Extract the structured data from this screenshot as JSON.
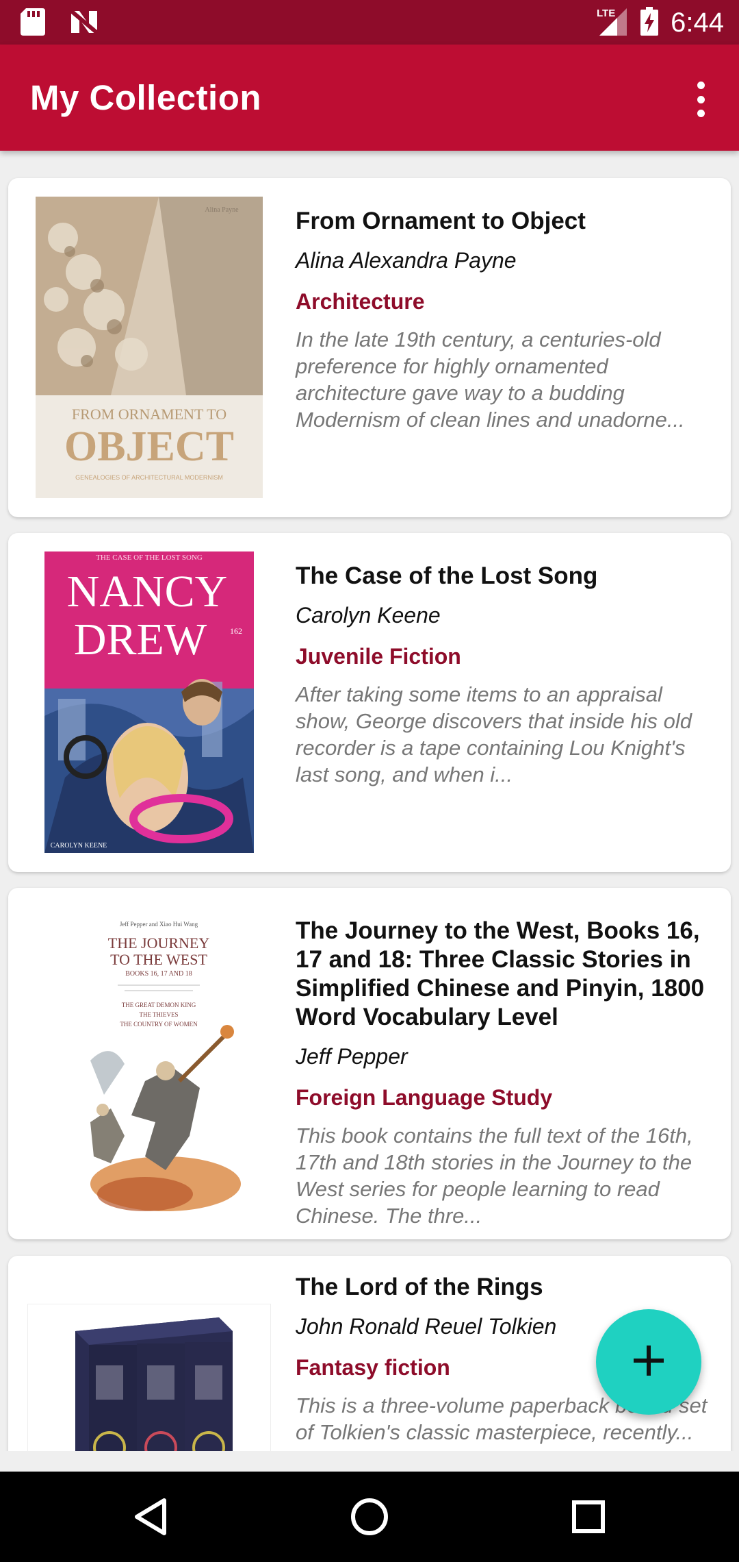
{
  "status_bar": {
    "time": "6:44",
    "network": "LTE",
    "icons": [
      "sd-card-icon",
      "notification-n-icon",
      "signal-icon",
      "battery-charging-icon"
    ]
  },
  "app_bar": {
    "title": "My Collection",
    "menu_icon": "overflow-menu-icon"
  },
  "books": [
    {
      "title": "From Ornament to Object",
      "author": "Alina Alexandra Payne",
      "category": "Architecture",
      "description": "In the late 19th century, a centuries-old preference for highly ornamented architecture gave way to a budding Modernism of clean lines and unadorne...",
      "cover": {
        "author_text": "Alina Payne",
        "line1": "FROM ORNAMENT TO",
        "line2": "OBJECT",
        "line3": "GENEALOGIES OF ARCHITECTURAL MODERNISM"
      }
    },
    {
      "title": "The Case of the Lost Song",
      "author": "Carolyn Keene",
      "category": "Juvenile Fiction",
      "description": "After taking some items to an appraisal show, George discovers that inside his old recorder is a tape containing Lou Knight's last song, and when i...",
      "cover": {
        "top_text": "THE CASE OF THE LOST SONG",
        "line1": "NANCY",
        "line2": "DREW",
        "number": "162",
        "author_text": "CAROLYN KEENE"
      }
    },
    {
      "title": "The Journey to the West, Books 16, 17 and 18: Three Classic Stories in Simplified Chinese and Pinyin, 1800 Word Vocabulary Level",
      "author": "Jeff Pepper",
      "category": "Foreign Language Study",
      "description": "This book contains the full text of the 16th, 17th and 18th stories in the Journey to the West series for people learning to read Chinese. The thre...",
      "cover": {
        "authors_text": "Jeff Pepper and Xiao Hui Wang",
        "line1": "THE JOURNEY",
        "line2": "TO THE WEST",
        "line3": "BOOKS 16, 17 AND 18",
        "stories": [
          "THE GREAT DEMON KING",
          "THE THIEVES",
          "THE COUNTRY OF WOMEN"
        ]
      }
    },
    {
      "title": "The Lord of the Rings",
      "author": "John Ronald Reuel Tolkien",
      "category": "Fantasy fiction",
      "description": "This is a three-volume paperback boxed set of Tolkien's classic masterpiece, recently..."
    }
  ],
  "fab": {
    "icon": "plus-icon"
  },
  "nav_bar": {
    "buttons": [
      "back-icon",
      "home-icon",
      "recents-icon"
    ]
  },
  "colors": {
    "status_bar": "#8e0c2a",
    "app_bar": "#bd0d33",
    "category_text": "#8e0c2a",
    "fab": "#1fd1c1"
  }
}
